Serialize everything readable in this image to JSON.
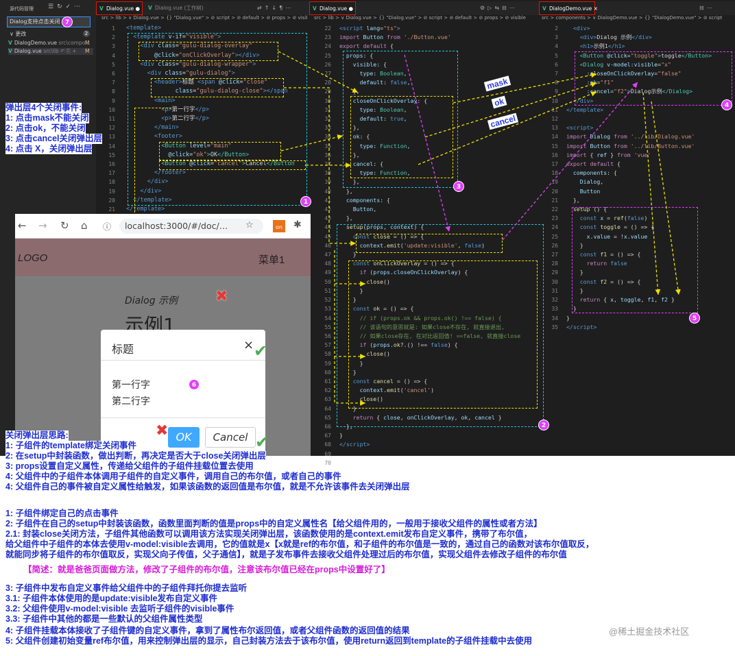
{
  "sidebar": {
    "header": "源代码管理",
    "commit_message": "Dialog支持点击关闭",
    "changes_label": "更改",
    "changes_count": "2",
    "files": [
      {
        "name": "DialogDemo.vue",
        "path": "src\\compo...",
        "status": "M"
      },
      {
        "name": "Dialog.vue",
        "path": "src\\lib",
        "status": "M"
      }
    ]
  },
  "pane1": {
    "tabs": [
      "Dialog.vue",
      "Dialog.vue (工作树)"
    ],
    "breadcrumb": "src > lib > ∨ Dialog.vue > {} \"Dialog.vue\" > ⊘ script > ⊘ default > ⊘ props > ⊘ visible",
    "line_start": 1
  },
  "pane2": {
    "tabs": [
      "Dialog.vue"
    ],
    "breadcrumb": "src > lib > ∨ Dialog.vue > {} \"Dialog.vue\" > ⊘ script > ⊘ default > ⊘ props > ⊘ visible",
    "line_start": 22
  },
  "pane3": {
    "tabs": [
      "DialogDemo.vue"
    ],
    "breadcrumb": "src > components > ∨ DialogDemo.vue > {} \"DialogDemo.vue\" > ⊘ script",
    "line_start": 2
  },
  "arrow_labels": {
    "mask": "mask",
    "ok": "ok",
    "cancel": "cancel"
  },
  "badges": [
    "1",
    "2",
    "3",
    "4",
    "5",
    "6",
    "7"
  ],
  "browser": {
    "url": "localhost:3000/#/doc/…",
    "ext_label": "on",
    "logo": "LOGO",
    "menu": "菜单1",
    "demo_subtitle": "Dialog 示例",
    "demo_title": "示例1",
    "dialog": {
      "title": "标题",
      "close": "×",
      "line1": "第一行字",
      "line2": "第二行字",
      "ok": "OK",
      "cancel": "Cancel"
    }
  },
  "left_notes": {
    "title": "弹出层4个关闭事件:",
    "items": [
      "1: 点击mask不能关闭",
      "2: 点击ok，不能关闭",
      "3: 点击cancel关闭弹出层",
      "4: 点击 X，关闭弹出层"
    ]
  },
  "ideas": {
    "title": "关闭弹出层思路:",
    "items": [
      "1: 子组件的template绑定关闭事件",
      "2: 在setup中封装函数，做出判断，再决定是否大于close关闭弹出层",
      "3: props设置自定义属性，传递给父组件的子组件挂载位置去使用",
      "4: 父组件中的子组件本体调用子组件的自定义事件，调用自己的布尔值，或者自己的事件",
      "4: 父组件自己的事件被自定义属性给触发，如果该函数的返回值是布尔值，就是不允许该事件去关闭弹出层"
    ]
  },
  "explain": [
    "1: 子组件绑定自己的点击事件",
    "2: 子组件在自己的setup中封装该函数，函数里面判断的值是props中的自定义属性名【给父组件用的，一般用于接收父组件的属性或者方法】",
    "2.1: 封装close关闭方法，子组件其他函数可以调用该方法实现关闭弹出层，该函数使用的是context.emit发布自定义事件，携带了布尔值，",
    "给父组件中子组件的本体去使用v-model:visible去调用，它的值就是x【x就是ref的布尔值，和子组件的布尔值是一致的，通过自己的函数对该布尔值取反，",
    "就能同步将子组件的布尔值取反，实现父向子传值，父子通信】，就是子发布事件去接收父组件处理过后的布尔值，实现父组件去修改子组件的布尔值",
    "【简述：就是爸爸页面做方法，修改了子组件的布尔值，注意该布尔值已经在props中设置好了】",
    "3: 子组件中发布自定义事件给父组件中的子组件拜托你提去监听",
    "3.1: 子组件本体使用的是update:visible发布自定义事件",
    "3.2: 父组件使用v-model:visible 去监听子组件的visible事件",
    "3.3: 子组件中其他的都是一些默认的父组件属性类型",
    "4: 子组件挂载本体接收了子组件键的自定义事件，拿到了属性布尔返回值，或者父组件函数的返回值的结果",
    "5: 父组件创建初始变量ref布尔值，用来控制弹出层的显示，自己封装方法去于该布尔值，使用return返回到template的子组件挂载中去使用"
  ],
  "watermark": "@稀土掘金技术社区"
}
